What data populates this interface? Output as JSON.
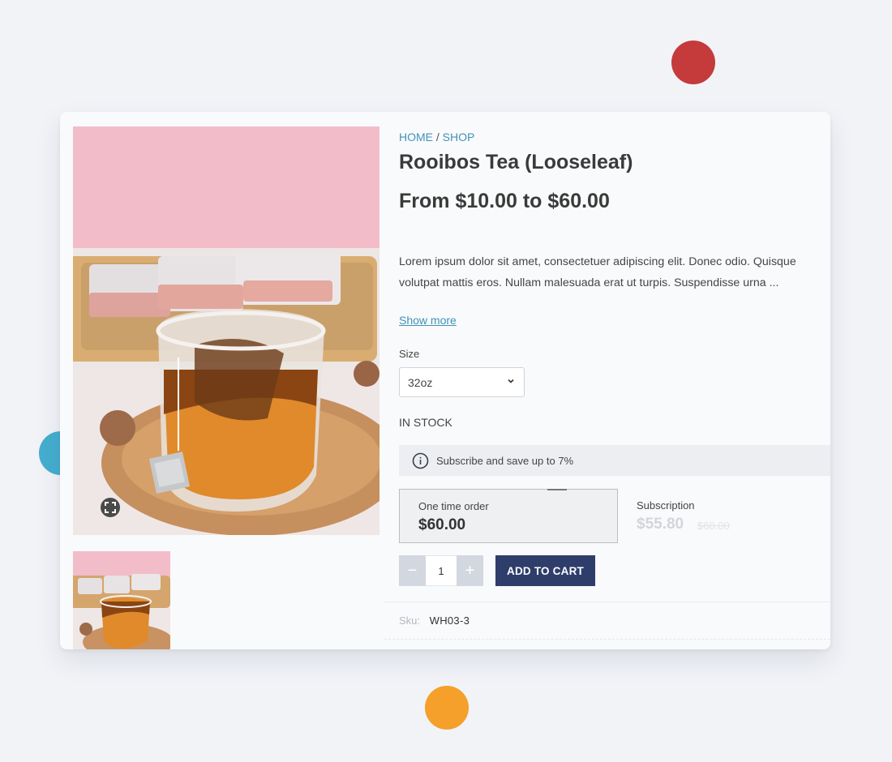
{
  "breadcrumb": {
    "home": "HOME",
    "separator": "/",
    "shop": "SHOP"
  },
  "product": {
    "title": "Rooibos Tea (Looseleaf)",
    "price_range": "From $10.00 to $60.00",
    "description": "Lorem ipsum dolor sit amet, consectetuer adipiscing elit. Donec odio. Quisque volutpat mattis eros. Nullam malesuada erat ut turpis. Suspendisse urna ...",
    "show_more": "Show more",
    "size_label": "Size",
    "size_value": "32oz",
    "stock_status": "IN STOCK",
    "subscribe_banner": "Subscribe and save up to 7%",
    "one_time": {
      "label": "One time order",
      "price": "$60.00"
    },
    "subscription": {
      "label": "Subscription",
      "price": "$55.80",
      "original_price": "$60.00"
    },
    "quantity": "1",
    "qty_minus": "−",
    "qty_plus": "+",
    "add_to_cart": "ADD TO CART",
    "sku_label": "Sku:",
    "sku_value": "WH03-3"
  },
  "icons": {
    "zoom": "fullscreen-icon",
    "info": "info-icon",
    "select": "chevron-down-icon"
  },
  "colors": {
    "link": "#3f93b8",
    "button": "#2f3d6b",
    "background": "#f1f3f7",
    "accent_red": "#c53a3a",
    "accent_blue": "#45aecf",
    "accent_orange": "#f5a02a"
  }
}
